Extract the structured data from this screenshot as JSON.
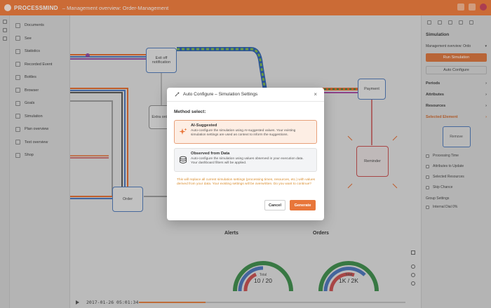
{
  "app": {
    "brand": "PROCESSMIND",
    "title": "– Management overview: Order-Management"
  },
  "sidenav": {
    "items": [
      {
        "label": "Documents",
        "icon": "document-icon"
      },
      {
        "label": "See",
        "icon": "eye-icon"
      },
      {
        "label": "Statistics",
        "icon": "bar-chart-icon"
      },
      {
        "label": "Recorded Event",
        "icon": "record-icon"
      },
      {
        "label": "Bottles",
        "icon": "bottle-icon"
      },
      {
        "label": "Browser",
        "icon": "browser-icon"
      },
      {
        "label": "Goals",
        "icon": "target-icon"
      },
      {
        "label": "Simulation",
        "icon": "simulation-icon"
      },
      {
        "label": "Plan overview",
        "icon": "plan-icon"
      },
      {
        "label": "Text overview",
        "icon": "text-icon"
      },
      {
        "label": "Shop",
        "icon": "shop-icon"
      }
    ]
  },
  "canvas": {
    "nodes": {
      "exit_notification": "Exit off notification",
      "payment": "Payment",
      "extra_order": "Extra order",
      "reminder": "Reminder",
      "order": "Order"
    },
    "dashboard": {
      "alerts_title": "Alerts",
      "orders_title": "Orders",
      "alerts_total_label": "Total",
      "alerts_total_value": "10 / 20",
      "orders_total_label": "Total",
      "orders_total_value": "1K / 2K"
    },
    "timeline": {
      "timestamp": "2017-01-26 05:01:34",
      "progress": 0.25
    }
  },
  "right_panel": {
    "title": "Simulation",
    "scenario_label": "Management overview: Ordo",
    "run_button": "Run Simulation",
    "auto_configure": "Auto Configure",
    "sections": [
      "Periods",
      "Attributes",
      "Resources"
    ],
    "selected_section": "Selected Element",
    "selected_box": "Remove",
    "links": [
      "Processing Time",
      "Attributes to Update",
      "Selected Resources",
      "Skip Chance"
    ],
    "group_label": "Group Settings",
    "group_item": "Internal Dial 0%"
  },
  "modal": {
    "title": "Auto Configure – Simulation Settings",
    "method_label": "Method select:",
    "options": [
      {
        "title": "AI-Suggested",
        "description": "Auto-configure the simulation using AI-suggested values. Your existing simulation settings are used as context to inform the suggestions.",
        "selected": true
      },
      {
        "title": "Observed from Data",
        "description": "Auto-configure the simulation using values observed in your execution data. Your dashboard filters will be applied.",
        "selected": false
      }
    ],
    "warning": "This will replace all current simulation settings (processing times, resources, etc.) with values derived from your data. Your existing settings will be overwritten. Do you want to continue?",
    "cancel": "Cancel",
    "generate": "Generate"
  },
  "colors": {
    "accent": "#e8763a",
    "node_border": "#4f78b6"
  }
}
